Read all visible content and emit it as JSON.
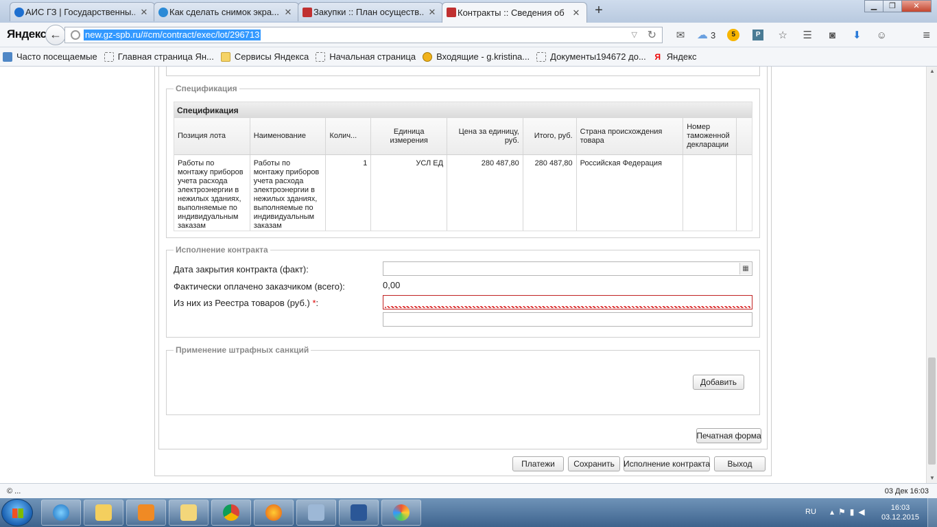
{
  "browser": {
    "tabs": [
      {
        "title": "АИС ГЗ | Государственны...",
        "icon": "globe-icon",
        "color": "#1e6fcf"
      },
      {
        "title": "Как сделать снимок экра...",
        "icon": "question-icon",
        "color": "#2b8ad6"
      },
      {
        "title": "Закупки :: План осуществ...",
        "icon": "tools-icon",
        "color": "#c03030"
      },
      {
        "title": "Контракты :: Сведения об ...",
        "icon": "tools-icon",
        "color": "#c03030"
      }
    ],
    "new_tab": "+",
    "brand": "Яндекс",
    "url": "new.gz-spb.ru/#cm/contract/exec/lot/296713",
    "weather_temp": "3",
    "coin_label": "5",
    "bookmarks": [
      {
        "label": "Часто посещаемые",
        "icon": "star"
      },
      {
        "label": "Главная страница Ян...",
        "icon": "page"
      },
      {
        "label": "Сервисы Яндекса",
        "icon": "folder"
      },
      {
        "label": "Начальная страница",
        "icon": "page"
      },
      {
        "label": "Входящие - g.kristina...",
        "icon": "mail"
      },
      {
        "label": "Документы194672 до...",
        "icon": "page"
      },
      {
        "label": "Яндекс",
        "icon": "ya"
      }
    ]
  },
  "spec": {
    "group_legend": "Спецификация",
    "grid_title": "Спецификация",
    "columns": [
      "Позиция лота",
      "Наименование",
      "Колич...",
      "Единица измерения",
      "Цена за единицу, руб.",
      "Итого, руб.",
      "Страна происхождения товара",
      "Номер таможенной декларации"
    ],
    "rows": [
      {
        "position": "Работы по монтажу приборов учета расхода электроэнергии в нежилых зданиях, выполняемые по индивидуальным заказам",
        "name": "Работы по монтажу приборов учета расхода электроэнергии в нежилых зданиях, выполняемые по индивидуальным заказам",
        "qty": "1",
        "unit": "УСЛ ЕД",
        "price": "280 487,80",
        "total": "280 487,80",
        "country": "Российская Федерация",
        "customs": ""
      }
    ]
  },
  "exec": {
    "legend": "Исполнение контракта",
    "close_date_label": "Дата закрытия контракта (факт):",
    "close_date_value": "",
    "paid_label": "Фактически оплачено заказчиком (всего):",
    "paid_value": "0,00",
    "registry_label": "Из них из Реестра товаров (руб.)",
    "registry_required": "*",
    "registry_colon": ":",
    "registry_value": "",
    "extra_value": ""
  },
  "penalties": {
    "legend": "Применение штрафных санкций",
    "add_button": "Добавить"
  },
  "buttons": {
    "print": "Печатная форма",
    "payments": "Платежи",
    "save": "Сохранить",
    "execution": "Исполнение контракта",
    "exit": "Выход"
  },
  "status": {
    "left": "© ...",
    "right": "03 Дек 16:03"
  },
  "taskbar": {
    "lang": "RU",
    "time": "16:03",
    "date": "03.12.2015"
  }
}
